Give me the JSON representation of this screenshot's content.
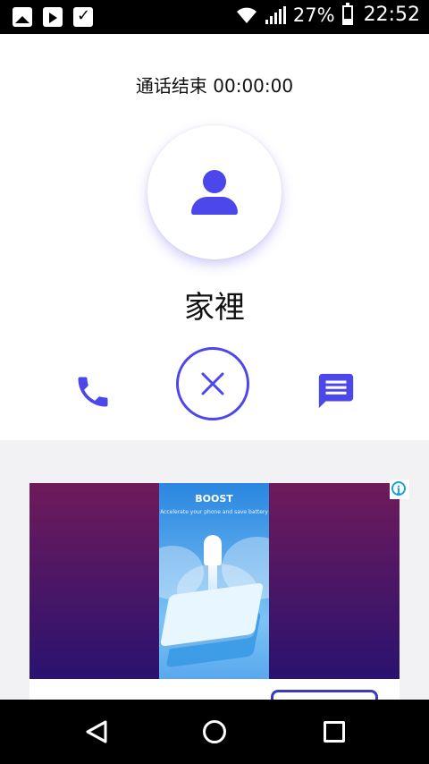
{
  "status_bar": {
    "battery": "27%",
    "time": "22:52",
    "icons": [
      "image-icon",
      "play-store-icon",
      "task-check-icon",
      "wifi-icon",
      "signal-icon",
      "battery-icon"
    ]
  },
  "call": {
    "status": "通话结束",
    "duration": "00:00:00",
    "contact_name": "家裡"
  },
  "actions": {
    "icons": [
      "phone-icon",
      "close-icon",
      "message-icon"
    ]
  },
  "ad": {
    "title": "BOOST",
    "subtitle": "Accelerate your phone and save battery"
  },
  "colors": {
    "accent": "#4b47ea",
    "status_bar": "#000000",
    "background": "#f2f2f5"
  }
}
